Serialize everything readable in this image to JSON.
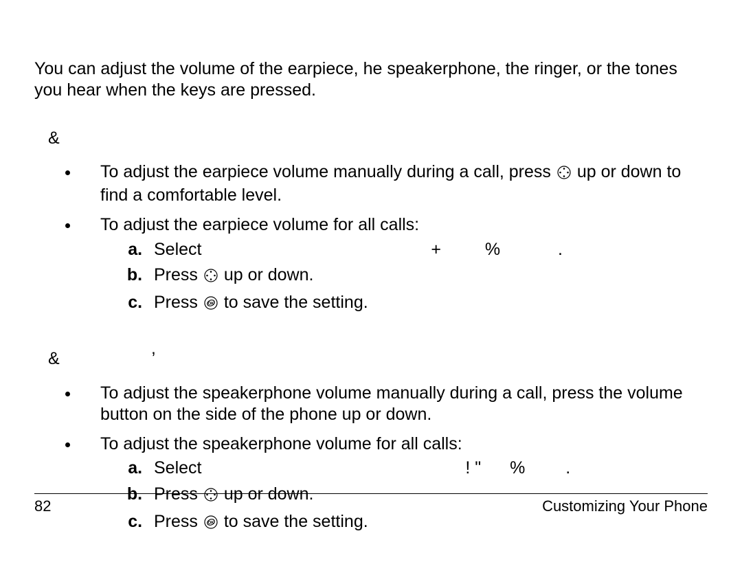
{
  "intro": "You can adjust the volume of the earpiece, he speakerphone, the ringer, or the tones you hear when the keys are pressed.",
  "section1": {
    "prefix": "&",
    "items": [
      {
        "before": "To adjust the earpiece volume manually during a call, press ",
        "icon": "nav",
        "after": " up or down to find a comfortable level."
      },
      {
        "text": "To adjust the earpiece volume for all calls:",
        "steps": [
          {
            "before": "Select",
            "extra1": "+",
            "extra2": "%",
            "extra3": "."
          },
          {
            "before": "Press ",
            "icon": "nav",
            "after": " up or down."
          },
          {
            "before": "Press ",
            "icon": "ok",
            "after": " to save the setting."
          }
        ]
      }
    ]
  },
  "section2": {
    "prefix": "&",
    "prefix_extra": "’",
    "items": [
      {
        "text": "To adjust the speakerphone volume manually during a call, press the volume button on the side of the phone up or down."
      },
      {
        "text": "To adjust the speakerphone volume for all calls:",
        "steps": [
          {
            "before": "Select",
            "extra1": "!  \"",
            "extra2": "%",
            "extra3": "."
          },
          {
            "before": "Press ",
            "icon": "nav",
            "after": " up or down."
          },
          {
            "before": "Press ",
            "icon": "ok",
            "after": " to save the setting."
          }
        ]
      }
    ]
  },
  "footer": {
    "page": "82",
    "title": "Customizing Your Phone"
  }
}
